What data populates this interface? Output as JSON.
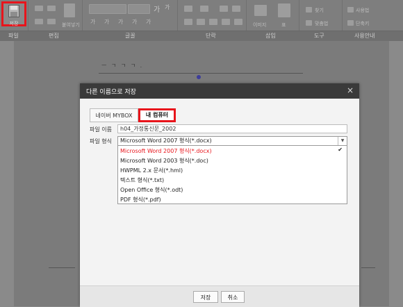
{
  "ribbon": {
    "save_label": "저장",
    "paste_label": "붙여넣기",
    "group_labels": [
      "파일",
      "편집",
      "글꼴",
      "단락",
      "삽입",
      "도구",
      "사용안내"
    ],
    "image_label": "이미지",
    "table_label": "표",
    "find_label": "찾기",
    "replace_label": "맞춤법",
    "guide_label": "사용법",
    "shortcut_label": "단축키",
    "font_buttons": [
      "가",
      "가",
      "가",
      "가",
      "가"
    ]
  },
  "document": {
    "sample_text": "ㅡ ㄱ ㄱ ㄱ   ."
  },
  "dialog": {
    "title": "다른 이름으로 저장",
    "close_glyph": "×",
    "tabs": [
      "네이버 MYBOX",
      "내 컴퓨터"
    ],
    "file_name_label": "파일 이름",
    "file_name_value": "h04_가정통신문_2002",
    "file_type_label": "파일 형식",
    "file_type_selected": "Microsoft Word 2007 형식(*.docx)",
    "file_type_options": [
      "Microsoft Word 2007 형식(*.docx)",
      "Microsoft Word 2003 형식(*.doc)",
      "HWPML 2.x 문서(*.hml)",
      "텍스트 형식(*.txt)",
      "Open Office 형식(*.odt)",
      "PDF 형식(*.pdf)"
    ],
    "check_glyph": "✔",
    "save_button": "저장",
    "cancel_button": "취소"
  },
  "colors": {
    "highlight": "#e8141b",
    "title_bar": "#3a3a3a"
  }
}
